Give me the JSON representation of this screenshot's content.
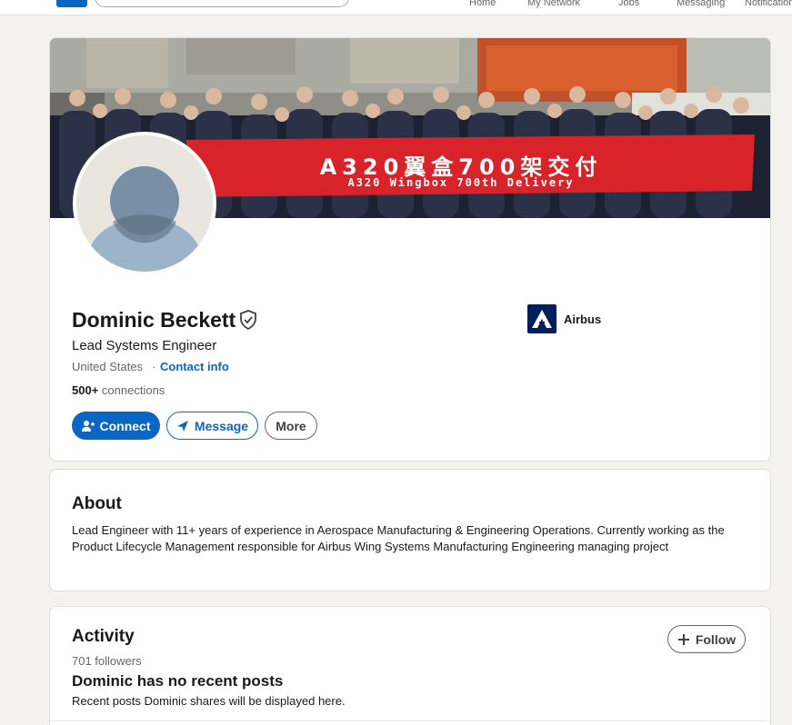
{
  "nav": {
    "items": [
      "Home",
      "My Network",
      "Jobs",
      "Messaging",
      "Notifications"
    ]
  },
  "banner": {
    "line1": "A320翼盒700架交付",
    "line2": "A320 Wingbox 700th Delivery"
  },
  "profile": {
    "name": "Dominic Beckett",
    "headline": "Lead Systems Engineer",
    "location": "United States",
    "location_separator": "·",
    "contact_label": "Contact info",
    "connections_count": "500+",
    "connections_label": "connections",
    "company": "Airbus"
  },
  "actions": {
    "connect_label": "Connect",
    "message_label": "Message",
    "more_label": "More"
  },
  "about": {
    "title": "About",
    "text": "Lead Engineer with 11+ years of experience in Aerospace Manufacturing & Engineering Operations. Currently working as the Product Lifecycle Management responsible for Airbus Wing Systems Manufacturing Engineering managing project"
  },
  "activity": {
    "title": "Activity",
    "followers": "701 followers",
    "follow_label": "Follow",
    "empty_title": "Dominic has no recent posts",
    "empty_sub": "Recent posts Dominic shares will be displayed here."
  },
  "colors": {
    "brand_blue": "#0a66c2",
    "airbus_navy": "#00205b",
    "banner_red": "#d8232a",
    "page_bg": "#f4f2ee"
  },
  "icons": [
    "verified-shield-icon",
    "add-person-icon",
    "send-icon",
    "plus-icon",
    "airbus-logo-icon",
    "default-avatar-icon"
  ]
}
